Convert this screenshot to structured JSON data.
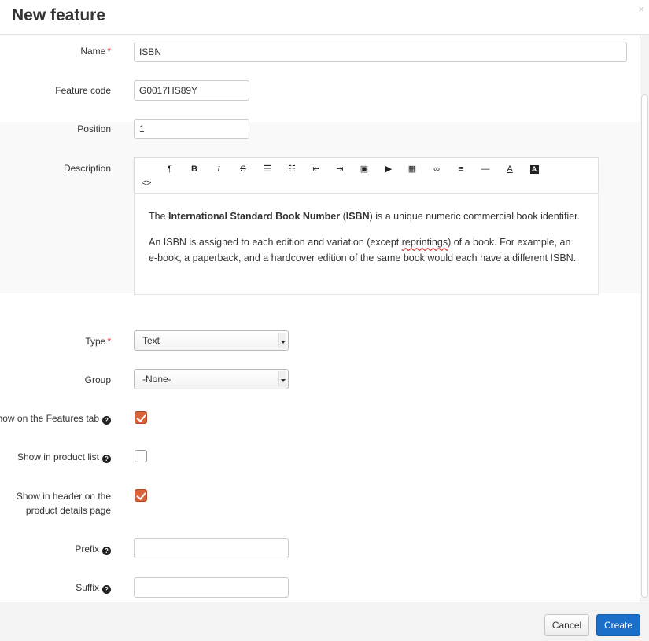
{
  "dialog": {
    "title": "New feature",
    "close_symbol": "×"
  },
  "form": {
    "name": {
      "label": "Name",
      "value": "ISBN",
      "required": "*"
    },
    "feature_code": {
      "label": "Feature code",
      "value": "G0017HS89Y"
    },
    "position": {
      "label": "Position",
      "value": "1"
    },
    "description": {
      "label": "Description",
      "toolbar": [
        {
          "icon": "paragraph-icon",
          "glyph": "¶"
        },
        {
          "icon": "bold-icon",
          "glyph": "B"
        },
        {
          "icon": "italic-icon",
          "glyph": "I"
        },
        {
          "icon": "strikethrough-icon",
          "glyph": "S"
        },
        {
          "icon": "unordered-list-icon",
          "glyph": "☰"
        },
        {
          "icon": "ordered-list-icon",
          "glyph": "☷"
        },
        {
          "icon": "outdent-icon",
          "glyph": "⇤"
        },
        {
          "icon": "indent-icon",
          "glyph": "⇥"
        },
        {
          "icon": "image-icon",
          "glyph": "▣"
        },
        {
          "icon": "video-icon",
          "glyph": "▶"
        },
        {
          "icon": "table-icon",
          "glyph": "▦"
        },
        {
          "icon": "link-icon",
          "glyph": "∞"
        },
        {
          "icon": "align-icon",
          "glyph": "≡"
        },
        {
          "icon": "horizontal-rule-icon",
          "glyph": "—"
        },
        {
          "icon": "font-color-icon",
          "glyph": "A"
        },
        {
          "icon": "background-color-icon",
          "glyph": "A"
        },
        {
          "icon": "source-code-icon",
          "glyph": "<>"
        }
      ],
      "paragraph1": {
        "before": "The ",
        "bold1": "International Standard Book Number",
        "middle": " (",
        "bold2": "ISBN",
        "after": ") is a unique numeric commercial book identifier."
      },
      "paragraph2": {
        "before": "An ISBN is assigned to each edition and variation (except ",
        "misspelled": "reprintings",
        "line1_after": ") of a book. For example, an",
        "line2": "e-book, a paperback, and a hardcover edition of the same book would each have a different ISBN."
      }
    },
    "type": {
      "label": "Type",
      "value": "Text",
      "required": "*"
    },
    "group": {
      "label": "Group",
      "value": "-None-"
    },
    "show_on_features_tab": {
      "label": "Show on the Features tab",
      "checked": true
    },
    "show_in_product_list": {
      "label": "Show in product list",
      "checked": false
    },
    "show_in_header": {
      "label_line1": "Show in header on the",
      "label_line2": "product details page",
      "checked": true
    },
    "prefix": {
      "label": "Prefix",
      "value": ""
    },
    "suffix": {
      "label": "Suffix",
      "value": ""
    },
    "help_symbol": "?"
  },
  "footer": {
    "cancel_label": "Cancel",
    "create_label": "Create"
  },
  "colors": {
    "accent": "#1c6fc9",
    "checkbox": "#d9643a",
    "required": "#e02020"
  }
}
